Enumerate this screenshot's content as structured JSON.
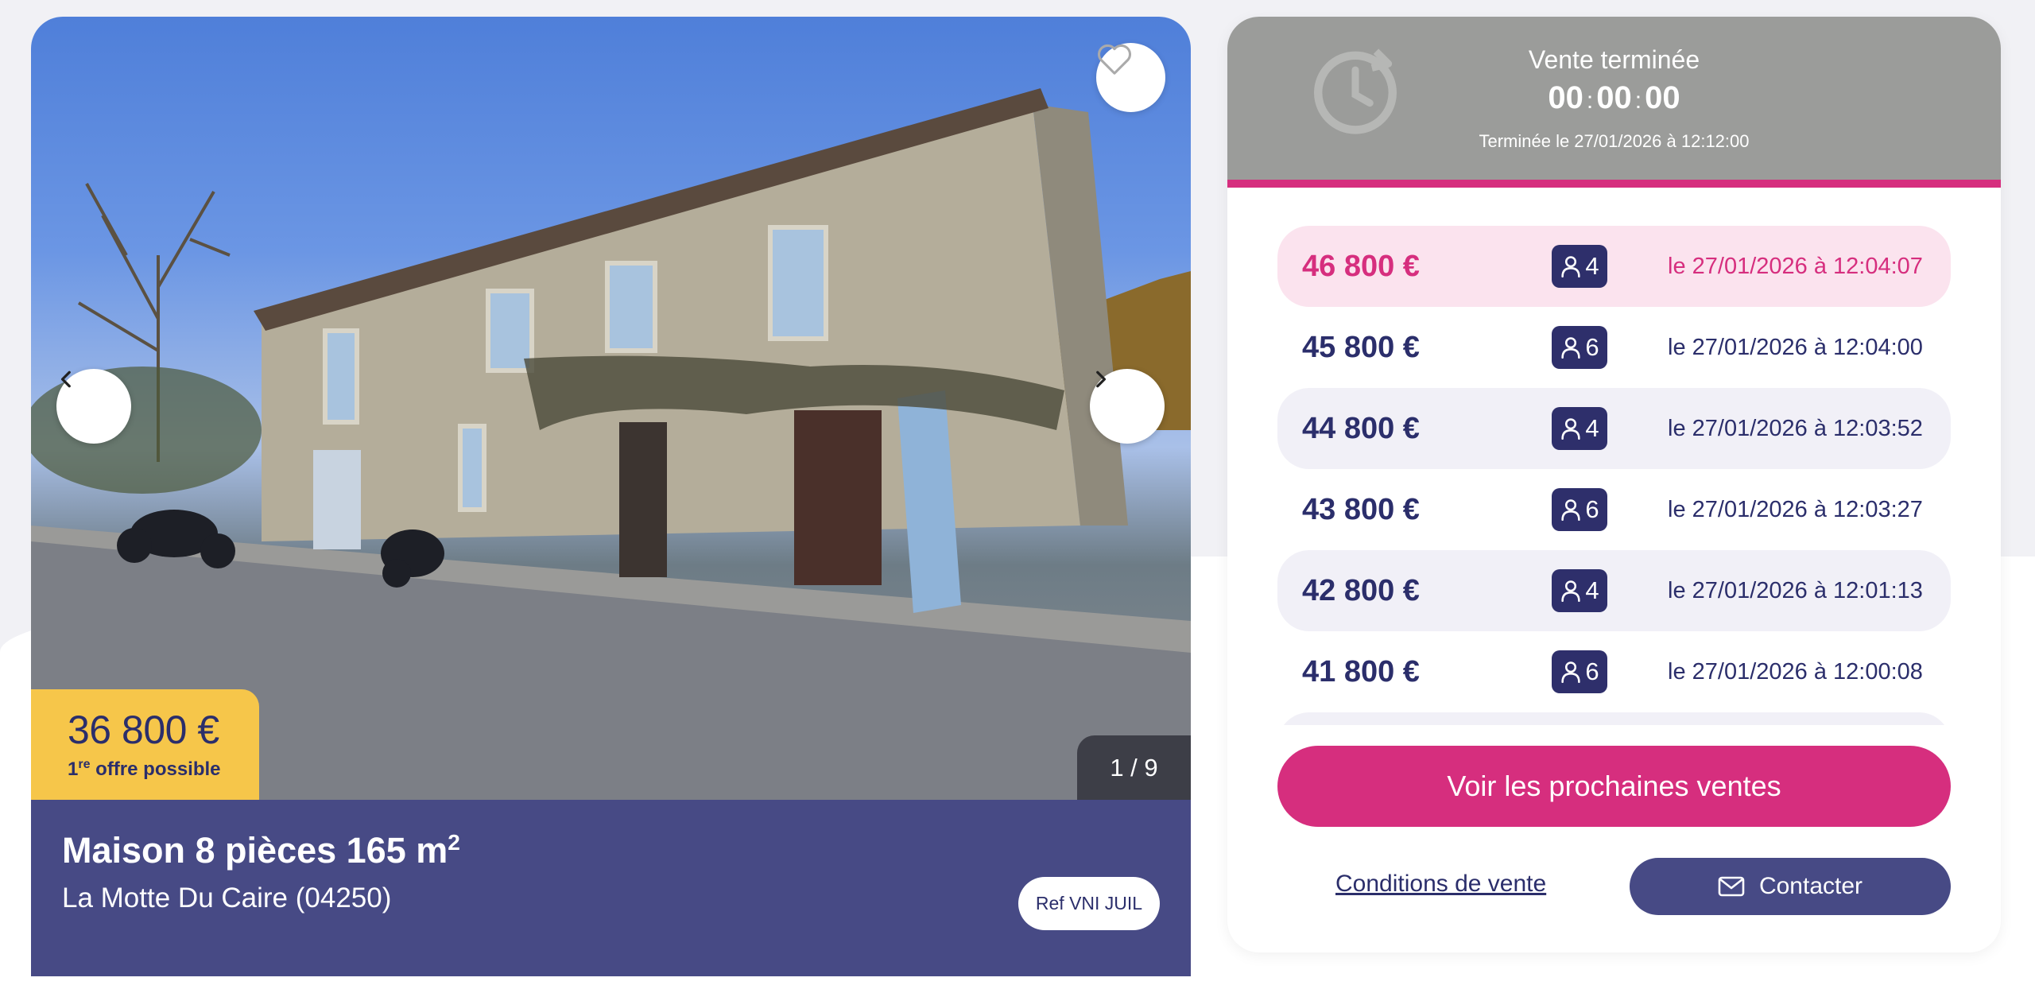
{
  "listing": {
    "price": "36 800 €",
    "first_offer_prefix": "1",
    "first_offer_sup": "re",
    "first_offer_suffix": " offre possible",
    "photo_counter": "1 / 9",
    "title": "Maison 8 pièces 165 m",
    "title_sup": "2",
    "location": "La Motte Du Caire (04250)",
    "ref": "Ref VNI JUIL"
  },
  "auction": {
    "status": "Vente terminée",
    "timer": {
      "hours": "00",
      "minutes": "00",
      "seconds": "00"
    },
    "ended_at": "Terminée le 27/01/2026 à 12:12:00",
    "bids": [
      {
        "amount": "46 800 €",
        "bidders": "4",
        "when": "le 27/01/2026 à 12:04:07"
      },
      {
        "amount": "45 800 €",
        "bidders": "6",
        "when": "le 27/01/2026 à 12:04:00"
      },
      {
        "amount": "44 800 €",
        "bidders": "4",
        "when": "le 27/01/2026 à 12:03:52"
      },
      {
        "amount": "43 800 €",
        "bidders": "6",
        "when": "le 27/01/2026 à 12:03:27"
      },
      {
        "amount": "42 800 €",
        "bidders": "4",
        "when": "le 27/01/2026 à 12:01:13"
      },
      {
        "amount": "41 800 €",
        "bidders": "6",
        "when": "le 27/01/2026 à 12:00:08"
      }
    ],
    "cta_label": "Voir les prochaines ventes",
    "conditions_label": "Conditions de vente",
    "contact_label": "Contacter"
  },
  "colors": {
    "brand_navy": "#474a85",
    "brand_pink": "#d62e7e",
    "price_yellow": "#f6c64a",
    "status_grey": "#9b9c9a"
  },
  "icons": [
    "heart-icon",
    "chevron-left-icon",
    "chevron-right-icon",
    "clock-history-icon",
    "person-icon",
    "mail-icon"
  ]
}
